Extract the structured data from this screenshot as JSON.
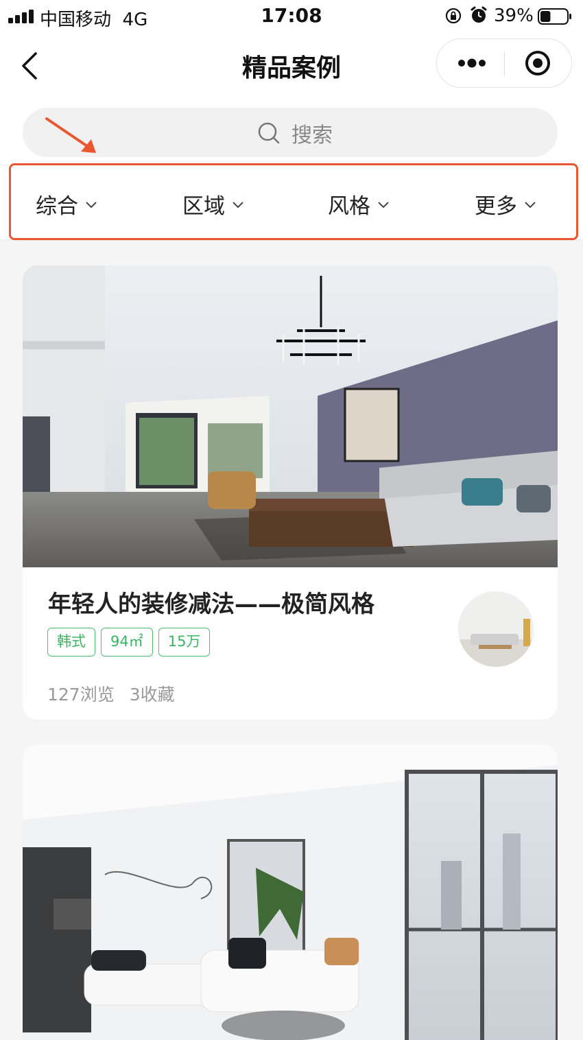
{
  "status_bar": {
    "carrier": "中国移动",
    "network": "4G",
    "time": "17:08",
    "battery_percent": "39%",
    "battery_level": 0.39
  },
  "nav": {
    "title": "精品案例",
    "back_icon": "chevron-left-icon",
    "more_icon": "more-dots-icon",
    "close_icon": "target-close-icon"
  },
  "search": {
    "placeholder": "搜索"
  },
  "filters": [
    {
      "label": "综合"
    },
    {
      "label": "区域"
    },
    {
      "label": "风格"
    },
    {
      "label": "更多"
    }
  ],
  "annotation": {
    "color": "#e9562f"
  },
  "cards": [
    {
      "title": "年轻人的装修减法——极简风格",
      "tags": [
        "韩式",
        "94㎡",
        "15万"
      ],
      "views": "127浏览",
      "favorites": "3收藏"
    }
  ],
  "colors": {
    "accent_green": "#3bb463",
    "page_bg": "#f5f5f5"
  }
}
